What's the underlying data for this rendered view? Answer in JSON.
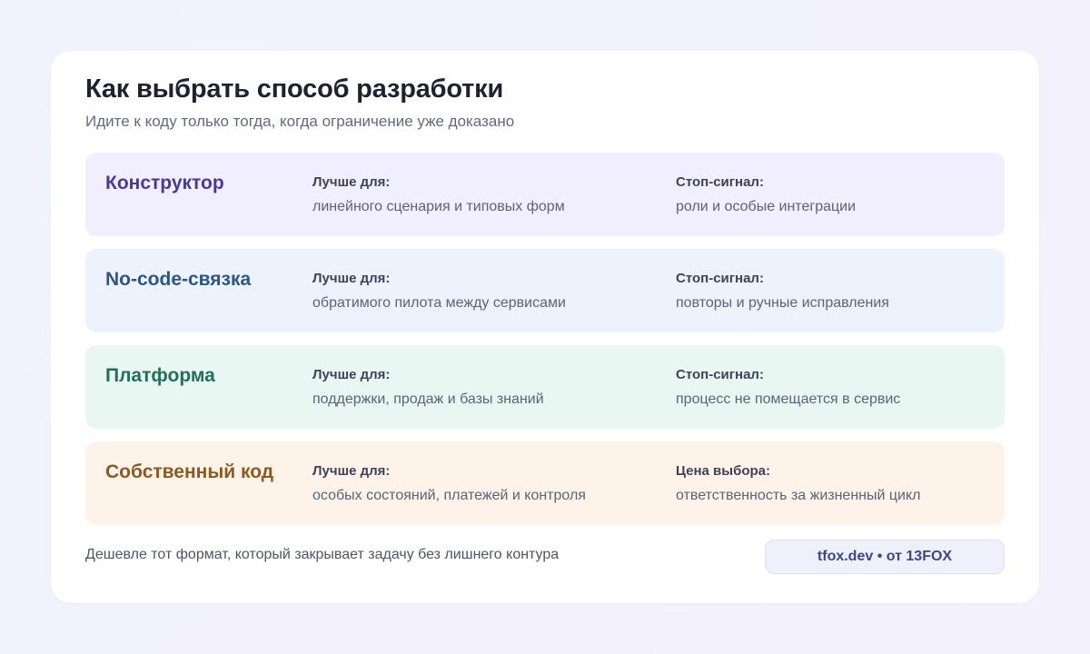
{
  "header": {
    "title": "Как выбрать способ разработки",
    "subtitle": "Идите к коду только тогда, когда ограничение уже доказано"
  },
  "rows": [
    {
      "name": "Конструктор",
      "best_label": "Лучше для:",
      "best_value": "линейного сценария и типовых форм",
      "stop_label": "Стоп-сигнал:",
      "stop_value": "роли и особые интеграции",
      "bg": "#f1effd",
      "accent": "#4b3a8f"
    },
    {
      "name": "No-code-связка",
      "best_label": "Лучше для:",
      "best_value": "обратимого пилота между сервисами",
      "stop_label": "Стоп-сигнал:",
      "stop_value": "повторы и ручные исправления",
      "bg": "#edf3fd",
      "accent": "#2e5685"
    },
    {
      "name": "Платформа",
      "best_label": "Лучше для:",
      "best_value": "поддержки, продаж и базы знаний",
      "stop_label": "Стоп-сигнал:",
      "stop_value": "процесс не помещается в сервис",
      "bg": "#e9f7f3",
      "accent": "#22705a"
    },
    {
      "name": "Собственный код",
      "best_label": "Лучше для:",
      "best_value": "особых состояний, платежей и контроля",
      "stop_label": "Цена выбора:",
      "stop_value": "ответственность за жизненный цикл",
      "bg": "#fef3e8",
      "accent": "#8b5a23"
    }
  ],
  "footer": {
    "note": "Дешевле тот формат, который закрывает задачу без лишнего контура",
    "badge": "tfox.dev • от 13FOX"
  }
}
